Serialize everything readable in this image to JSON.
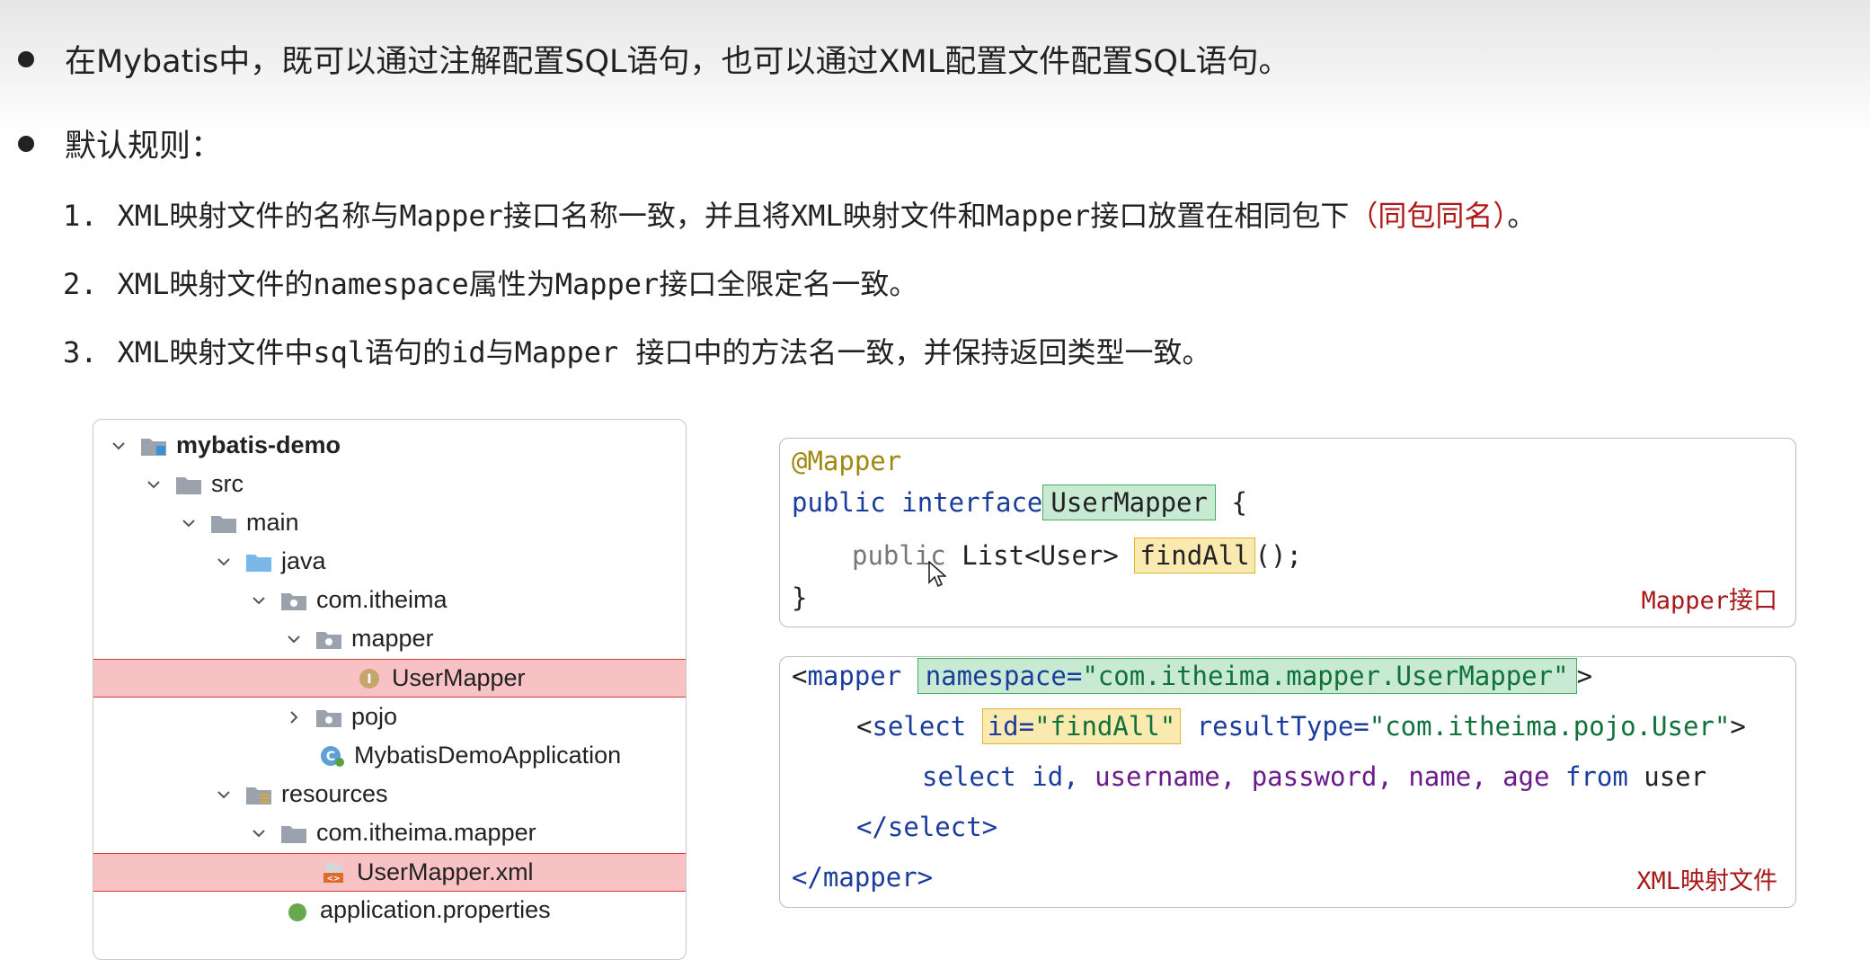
{
  "bullets": {
    "b1": "在Mybatis中，既可以通过注解配置SQL语句，也可以通过XML配置文件配置SQL语句。",
    "b2": "默认规则："
  },
  "rules": [
    {
      "num": "1.",
      "text": "XML映射文件的名称与Mapper接口名称一致，并且将XML映射文件和Mapper接口放置在相同包下",
      "highlight": "（同包同名）",
      "tail": "。"
    },
    {
      "num": "2.",
      "text": "XML映射文件的namespace属性为Mapper接口全限定名一致。"
    },
    {
      "num": "3.",
      "text": "XML映射文件中sql语句的id与Mapper 接口中的方法名一致，并保持返回类型一致。"
    }
  ],
  "tree": {
    "items": [
      {
        "label": "mybatis-demo",
        "icon": "module-folder-icon",
        "expanded": true
      },
      {
        "label": "src",
        "icon": "folder-icon",
        "expanded": true
      },
      {
        "label": "main",
        "icon": "folder-icon",
        "expanded": true
      },
      {
        "label": "java",
        "icon": "source-folder-icon",
        "expanded": true
      },
      {
        "label": "com.itheima",
        "icon": "package-icon",
        "expanded": true
      },
      {
        "label": "mapper",
        "icon": "package-icon",
        "expanded": true
      },
      {
        "label": "UserMapper",
        "icon": "interface-icon",
        "highlighted": true
      },
      {
        "label": "pojo",
        "icon": "package-icon",
        "expanded": false
      },
      {
        "label": "MybatisDemoApplication",
        "icon": "spring-class-icon"
      },
      {
        "label": "resources",
        "icon": "resources-folder-icon",
        "expanded": true
      },
      {
        "label": "com.itheima.mapper",
        "icon": "folder-icon",
        "expanded": true
      },
      {
        "label": "UserMapper.xml",
        "icon": "xml-file-icon",
        "highlighted": true
      },
      {
        "label": "application.properties",
        "icon": "properties-file-icon"
      }
    ]
  },
  "mapper_code": {
    "annotation": "@Mapper",
    "kw_public": "public",
    "kw_interface": "interface",
    "iface_name": "UserMapper",
    "open_brace": "{",
    "method_public": "public",
    "method_ret": "List<User>",
    "method_name": "findAll",
    "method_tail": "();",
    "close_brace": "}",
    "label": "Mapper接口"
  },
  "xml_code": {
    "lt": "<",
    "mapper_tag": "mapper",
    "ns_attr": "namespace=",
    "ns_value": "\"com.itheima.mapper.UserMapper\"",
    "gt": ">",
    "select_tag": "select",
    "id_attr": "id=",
    "id_value": "\"findAll\"",
    "rt_attr": "resultType=",
    "rt_value": "\"com.itheima.pojo.User\"",
    "sql_select": "select",
    "sql_id": "id,",
    "sql_username": "username,",
    "sql_password": "password,",
    "sql_name": "name,",
    "sql_age": "age",
    "sql_from": "from",
    "sql_user": "user",
    "select_close": "</select>",
    "mapper_close": "</mapper>",
    "label": "XML映射文件"
  }
}
